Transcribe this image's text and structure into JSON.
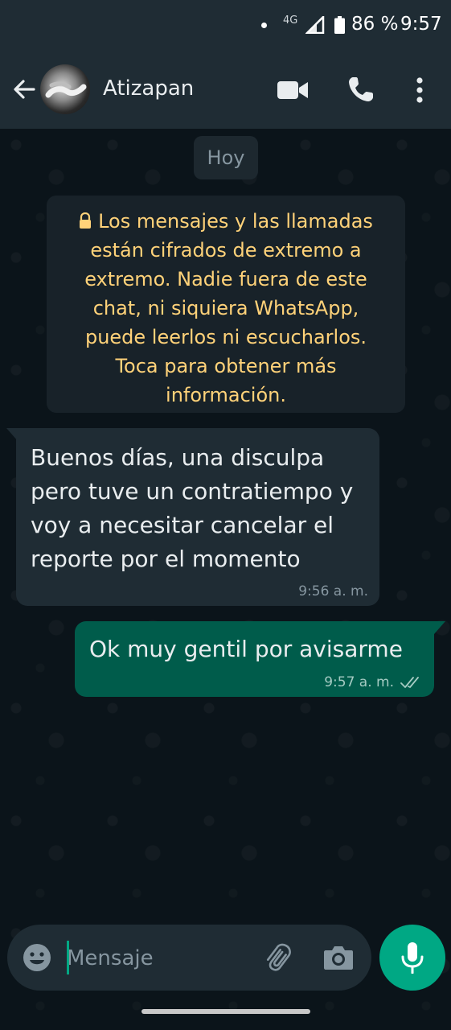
{
  "status_bar": {
    "network": "4G",
    "battery": "86 %",
    "time": "9:57"
  },
  "header": {
    "contact_name": "Atizapan",
    "icons": [
      "back-arrow-icon",
      "avatar",
      "video-call-icon",
      "voice-call-icon",
      "more-options-icon"
    ]
  },
  "chat": {
    "date_chip": "Hoy",
    "encryption_notice": "Los mensajes y las llamadas están cifrados de extremo a extremo. Nadie fuera de este chat, ni siquiera WhatsApp, puede leerlos ni escucharlos. Toca para obtener más información.",
    "messages": [
      {
        "direction": "incoming",
        "text": "Buenos días, una disculpa pero tuve un contratiempo y voy a necesitar cancelar el reporte por el momento",
        "time": "9:56 a. m."
      },
      {
        "direction": "outgoing",
        "text": "Ok muy gentil por avisarme",
        "time": "9:57 a. m.",
        "status": "delivered"
      }
    ]
  },
  "composer": {
    "placeholder": "Mensaje",
    "value": ""
  },
  "colors": {
    "header_bg": "#1f2c34",
    "chat_bg": "#0b141a",
    "incoming_bubble": "#1f2c34",
    "outgoing_bubble": "#005c4b",
    "accent": "#00a884",
    "notice_text": "#ffd279"
  }
}
